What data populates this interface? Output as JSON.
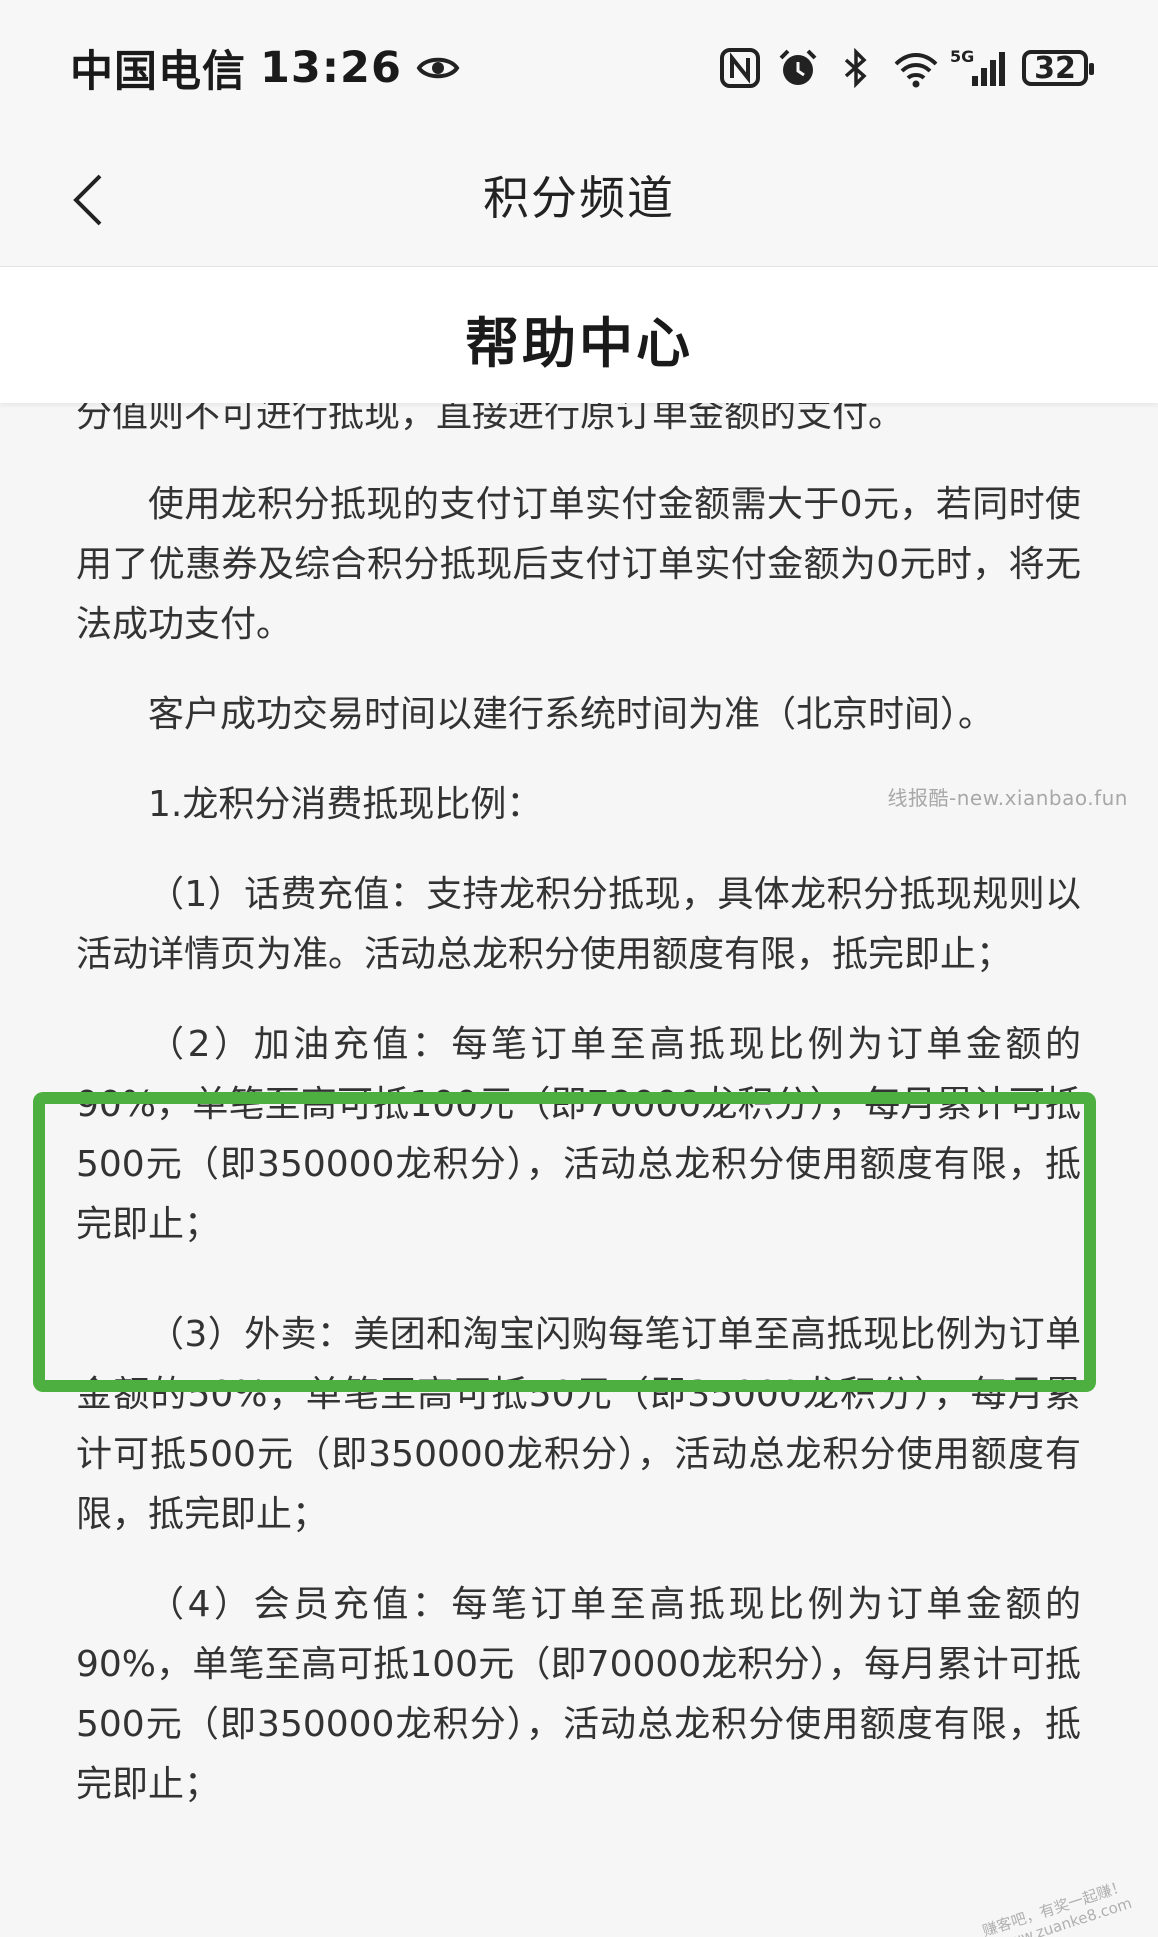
{
  "status_bar": {
    "carrier": "中国电信",
    "time": "13:26",
    "battery": "32",
    "icons": [
      "eye-icon",
      "nfc-icon",
      "alarm-icon",
      "bluetooth-icon",
      "wifi-icon",
      "signal-5g-icon",
      "battery-icon"
    ]
  },
  "nav": {
    "back_icon": "chevron-left-icon",
    "title": "积分频道"
  },
  "help": {
    "title": "帮助中心"
  },
  "content": {
    "paragraphs": [
      "分值则不可进行抵现，直接进行原订单金额的支付。",
      "使用龙积分抵现的支付订单实付金额需大于0元，若同时使用了优惠券及综合积分抵现后支付订单实付金额为0元时，将无法成功支付。",
      "客户成功交易时间以建行系统时间为准（北京时间）。",
      "1.龙积分消费抵现比例：",
      "（1）话费充值：支持龙积分抵现，具体龙积分抵现规则以活动详情页为准。活动总龙积分使用额度有限，抵完即止；",
      "（2）加油充值：每笔订单至高抵现比例为订单金额的90%，单笔至高可抵100元（即70000龙积分），每月累计可抵500元（即350000龙积分），活动总龙积分使用额度有限，抵完即止；",
      "（3）外卖：美团和淘宝闪购每笔订单至高抵现比例为订单金额的50%，单笔至高可抵50元（即35000龙积分），每月累计可抵500元（即350000龙积分），活动总龙积分使用额度有限，抵完即止；",
      "（4）会员充值：每笔订单至高抵现比例为订单金额的90%，单笔至高可抵100元（即70000龙积分），每月累计可抵500元（即350000龙积分），活动总龙积分使用额度有限，抵完即止；"
    ]
  },
  "watermarks": {
    "top": "线报酷-new.xianbao.fun",
    "corner_line1": "赚客吧，有奖一起赚！",
    "corner_line2": "www.zuanke8.com"
  },
  "colors": {
    "highlight_border": "#4caf3f"
  }
}
